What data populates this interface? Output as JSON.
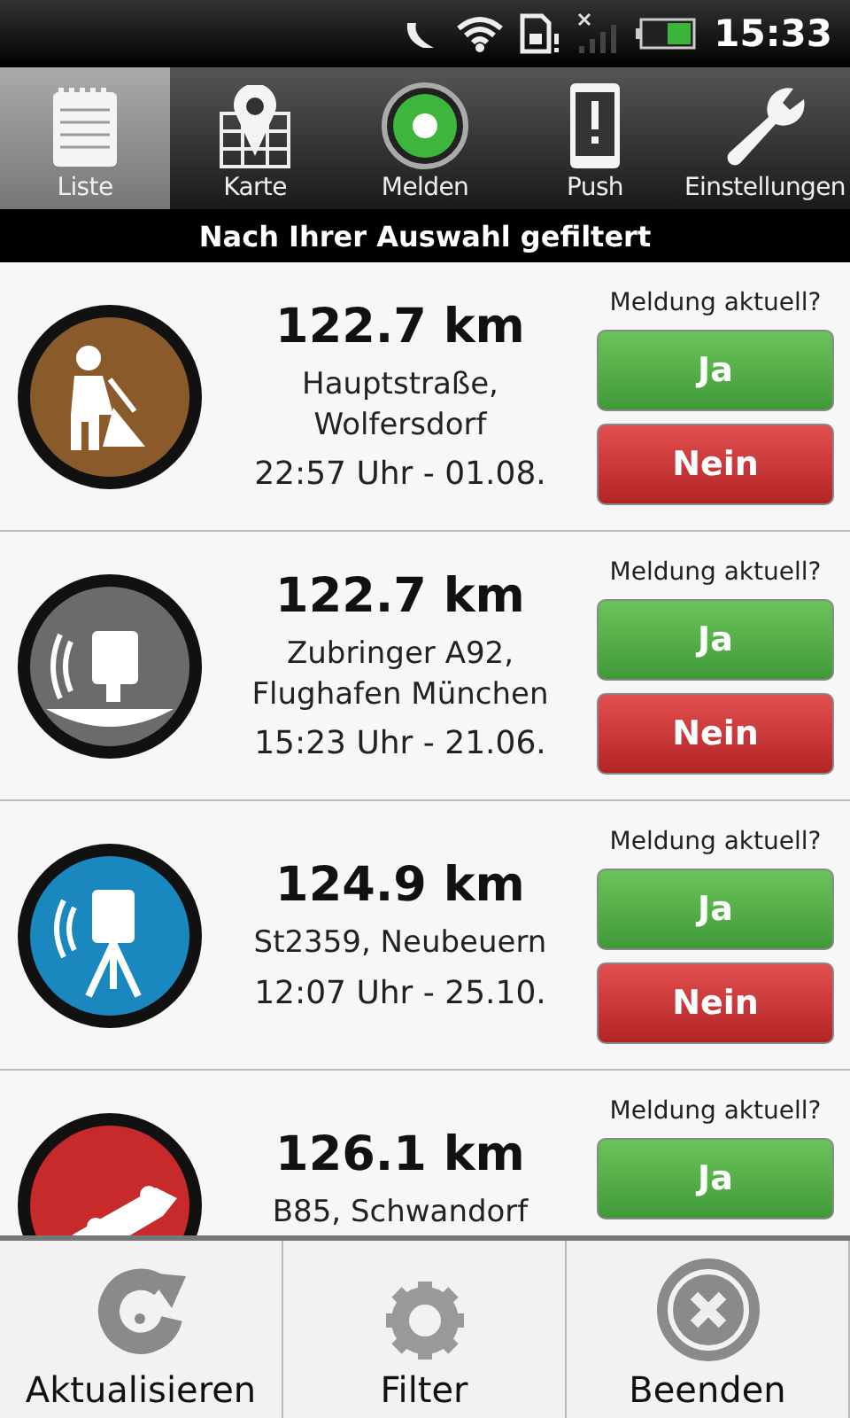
{
  "status_bar": {
    "time": "15:33"
  },
  "tabs": [
    {
      "label": "Liste",
      "selected": true
    },
    {
      "label": "Karte",
      "selected": false
    },
    {
      "label": "Melden",
      "selected": false
    },
    {
      "label": "Push",
      "selected": false
    },
    {
      "label": "Einstellungen",
      "selected": false
    }
  ],
  "filter_banner": "Nach Ihrer Auswahl gefiltert",
  "reports": [
    {
      "kind": "roadwork",
      "color": "#8b5a2b",
      "distance": "122.7 km",
      "location": "Hauptstraße, Wolfersdorf",
      "time": "22:57 Uhr - 01.08.",
      "question": "Meldung aktuell?",
      "yes": "Ja",
      "no": "Nein"
    },
    {
      "kind": "camera",
      "color": "#6b6b6b",
      "distance": "122.7 km",
      "location": "Zubringer A92, Flughafen München",
      "time": "15:23 Uhr - 21.06.",
      "question": "Meldung aktuell?",
      "yes": "Ja",
      "no": "Nein"
    },
    {
      "kind": "tripod_camera",
      "color": "#1b87bf",
      "distance": "124.9 km",
      "location": "St2359, Neubeuern",
      "time": "12:07 Uhr - 25.10.",
      "question": "Meldung aktuell?",
      "yes": "Ja",
      "no": "Nein"
    },
    {
      "kind": "accident",
      "color": "#c62a2a",
      "distance": "126.1 km",
      "location": "B85, Schwandorf",
      "question": "Meldung aktuell?",
      "yes": "Ja"
    }
  ],
  "menu": [
    {
      "label": "Aktualisieren"
    },
    {
      "label": "Filter"
    },
    {
      "label": "Beenden"
    }
  ]
}
